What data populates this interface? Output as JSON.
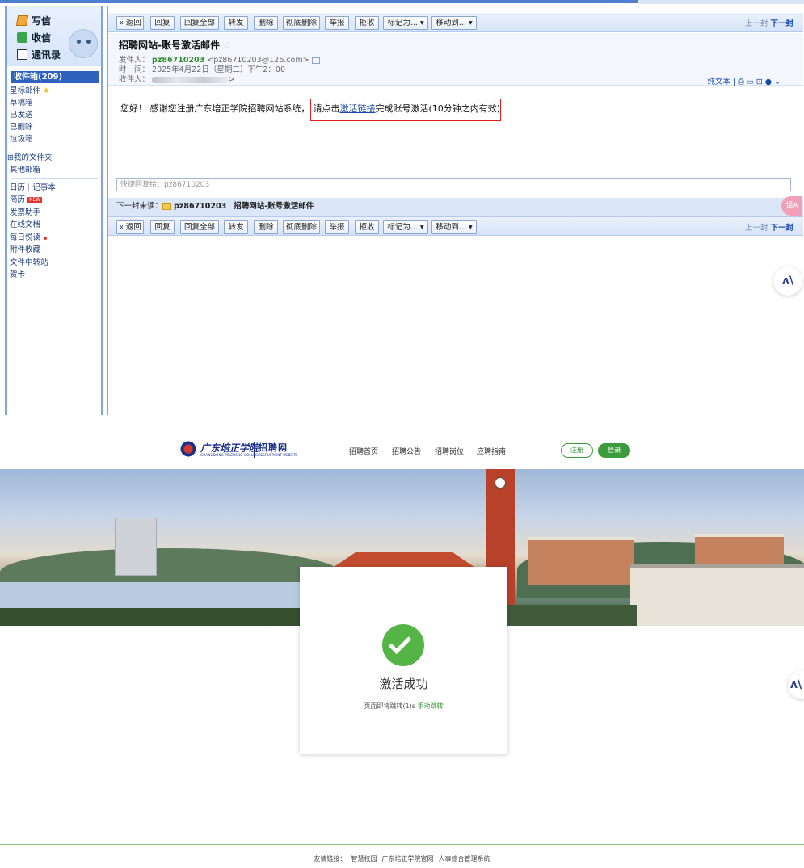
{
  "mail": {
    "sidebar": {
      "actions": {
        "write": "写信",
        "receive": "收信",
        "contacts": "通讯录"
      },
      "inbox": "收件箱(209)",
      "folders": [
        "星标邮件",
        "草稿箱",
        "已发送",
        "已删除",
        "垃圾箱"
      ],
      "my_folders": "我的文件夹",
      "other_mailbox": "其他邮箱",
      "calendar": "日历",
      "notes": "记事本",
      "tools": [
        {
          "label": "简历",
          "badge": "NEW"
        },
        {
          "label": "发票助手"
        },
        {
          "label": "在线文档"
        },
        {
          "label": "每日悦读"
        },
        {
          "label": "附件收藏"
        },
        {
          "label": "文件中转站"
        },
        {
          "label": "贺卡"
        }
      ]
    },
    "toolbar": {
      "buttons": [
        "« 返回",
        "回复",
        "回复全部",
        "转发",
        "删除",
        "彻底删除",
        "举报",
        "拒收",
        "标记为... ▾",
        "移动到... ▾"
      ],
      "prev": "上一封",
      "next": "下一封"
    },
    "message": {
      "subject": "招聘网站-账号激活邮件",
      "favorite": "☆",
      "from_label": "发件人：",
      "from_name": "pz86710203",
      "from_email": "<pz86710203@126.com>",
      "time_label": "时　间：",
      "time": "2025年4月22日（星期二）下午2：00",
      "to_label": "收件人：",
      "to_suffix": ">",
      "plain_text": "纯文本 | ⎙ ▭ ⊡ ● ⌄",
      "body_prefix": "您好！ 感谢您注册广东培正学院招聘网站系统，",
      "body_link_prefix": "请点击",
      "body_link": "激活链接",
      "body_suffix": "完成账号激活(10分钟之内有效)"
    },
    "quick_reply_placeholder": "快捷回复给：pz86710203",
    "next_unread": {
      "label": "下一封未读：",
      "sender": "pz86710203",
      "subject": "招聘网站-账号激活邮件"
    },
    "translate": "译A",
    "ai": "ʌ\\"
  },
  "site": {
    "logo": {
      "name_cn": "广东培正学院",
      "name_en": "GUANGDONG PEIZHENG COLLEGE",
      "site_cn": "招聘网",
      "site_en": "RECRUITMENT WEBSITE"
    },
    "nav": [
      "招聘首页",
      "招聘公告",
      "招聘岗位",
      "应聘指南"
    ],
    "register": "注册",
    "login": "登录",
    "card": {
      "title": "激活成功",
      "sub_prefix": "页面即将跳转(1)s ",
      "sub_link": "手动跳转"
    },
    "footer": {
      "label": "友情链接：",
      "links": [
        "智慧校园",
        "广东培正学院官网",
        "人事综合管理系统"
      ]
    }
  }
}
